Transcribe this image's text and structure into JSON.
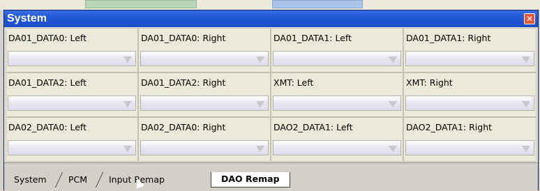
{
  "window": {
    "title": "System",
    "close_icon": "close-icon"
  },
  "fields": [
    {
      "label": "DA01_DATA0: Left"
    },
    {
      "label": "DA01_DATA0: Right"
    },
    {
      "label": "DA01_DATA1: Left"
    },
    {
      "label": "DA01_DATA1: Right"
    },
    {
      "label": "DA01_DATA2: Left"
    },
    {
      "label": "DA01_DATA2: Right"
    },
    {
      "label": "XMT: Left"
    },
    {
      "label": "XMT: Right"
    },
    {
      "label": "DA02_DATA0: Left"
    },
    {
      "label": "DA02_DATA0: Right"
    },
    {
      "label": "DAO2_DATA1: Left"
    },
    {
      "label": "DAO2_DATA1: Right"
    }
  ],
  "tabs": [
    {
      "label": "System"
    },
    {
      "label": "PCM"
    },
    {
      "label": "Input Remap"
    },
    {
      "label": "DAO Remap",
      "active": true
    }
  ]
}
